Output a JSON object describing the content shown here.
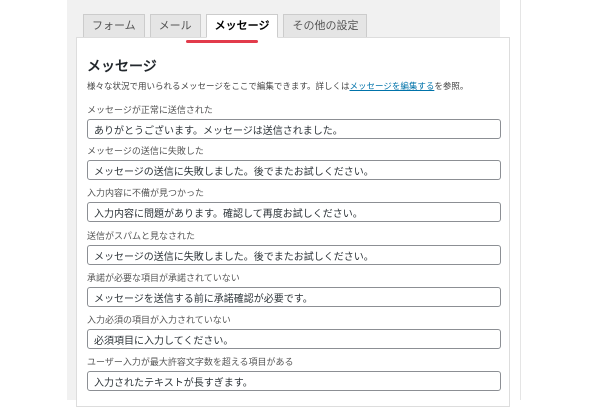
{
  "tabs": [
    {
      "label": "フォーム"
    },
    {
      "label": "メール"
    },
    {
      "label": "メッセージ"
    },
    {
      "label": "その他の設定"
    }
  ],
  "active_tab": "メッセージ",
  "accent_color": "#e23b4b",
  "section": {
    "title": "メッセージ",
    "desc_before": "様々な状況で用いられるメッセージをここで編集できます。詳しくは",
    "desc_link": "メッセージを編集する",
    "desc_after": "を参照。"
  },
  "fields": [
    {
      "label": "メッセージが正常に送信された",
      "value": "ありがとうございます。メッセージは送信されました。"
    },
    {
      "label": "メッセージの送信に失敗した",
      "value": "メッセージの送信に失敗しました。後でまたお試しください。"
    },
    {
      "label": "入力内容に不備が見つかった",
      "value": "入力内容に問題があります。確認して再度お試しください。"
    },
    {
      "label": "送信がスパムと見なされた",
      "value": "メッセージの送信に失敗しました。後でまたお試しください。"
    },
    {
      "label": "承諾が必要な項目が承諾されていない",
      "value": "メッセージを送信する前に承諾確認が必要です。"
    },
    {
      "label": "入力必須の項目が入力されていない",
      "value": "必須項目に入力してください。"
    },
    {
      "label": "ユーザー入力が最大許容文字数を超える項目がある",
      "value": "入力されたテキストが長すぎます。"
    }
  ]
}
